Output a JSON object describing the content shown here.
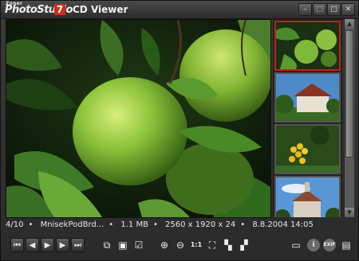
{
  "app": {
    "brand_small": "Zoner",
    "brand_name": "PhotoStudio",
    "brand_version": "7",
    "window_title": "CD Viewer"
  },
  "window_buttons": [
    {
      "name": "min",
      "glyph": "–"
    },
    {
      "name": "restore",
      "glyph": "⬚"
    },
    {
      "name": "max",
      "glyph": "□"
    },
    {
      "name": "close",
      "glyph": "✕"
    }
  ],
  "status": {
    "position": "4/10",
    "filename": "MnisekPodBrd...",
    "size": "1.1 MB",
    "dimensions": "2560 x 1920 x 24",
    "datetime": "8.8.2004 14:05"
  },
  "toolbar": {
    "nav": {
      "first": "⏮",
      "prev": "◀",
      "play": "▶",
      "next": "▶",
      "last": "⏭"
    },
    "file": {
      "copy": "⧉",
      "save": "▣",
      "check": "☑"
    },
    "zoom": {
      "zoom_in": "⊕",
      "zoom_out": "⊖",
      "actual": "1:1",
      "fit": "⛶",
      "grid1": "▚",
      "grid2": "▞"
    },
    "right": {
      "monitor": "▭",
      "info": "i",
      "exif": "EXIF",
      "panel": "▤"
    }
  },
  "thumbnails": [
    {
      "label": "green apples",
      "selected": true
    },
    {
      "label": "house roof",
      "selected": false
    },
    {
      "label": "yellow flowers",
      "selected": false
    },
    {
      "label": "castle tower",
      "selected": false
    }
  ],
  "colors": {
    "selection": "#c0201a",
    "brand_accent": "#d02c1a",
    "status_text": "#e6e6e6"
  }
}
